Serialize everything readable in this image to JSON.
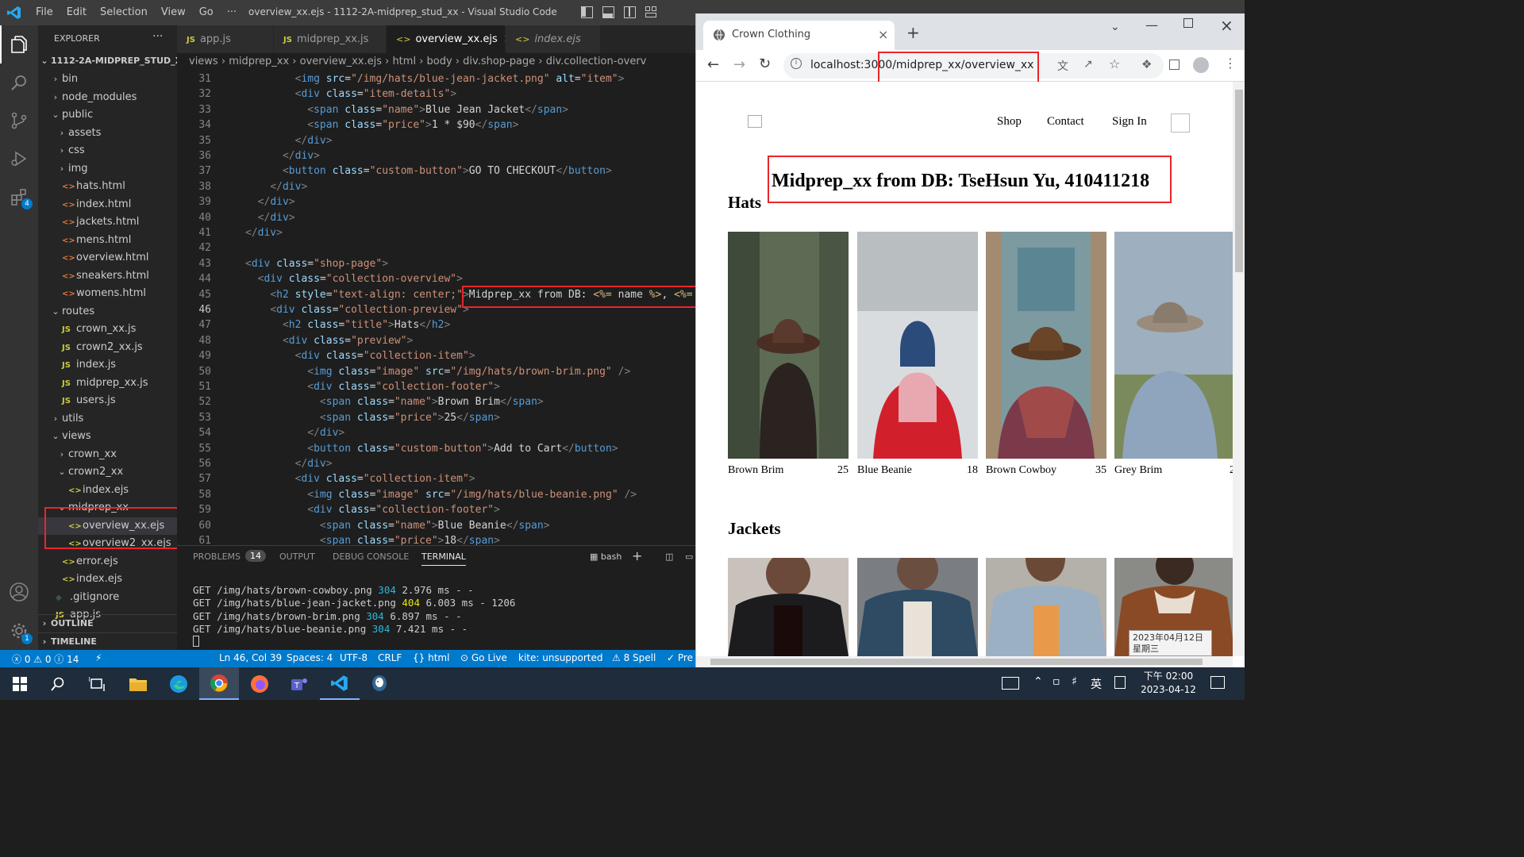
{
  "vscode": {
    "menu": [
      "File",
      "Edit",
      "Selection",
      "View",
      "Go",
      "···"
    ],
    "window_title": "overview_xx.ejs - 1112-2A-midprep_stud_xx - Visual Studio Code",
    "extensions_badge": "4",
    "settings_badge": "1"
  },
  "explorer": {
    "header": "EXPLORER",
    "more": "···",
    "root": "1112-2A-MIDPREP_STUD_XX",
    "items": [
      {
        "label": "bin",
        "kind": "folder",
        "chev": "›",
        "indent": 1
      },
      {
        "label": "node_modules",
        "kind": "folder",
        "chev": "›",
        "indent": 1
      },
      {
        "label": "public",
        "kind": "folder",
        "chev": "⌄",
        "indent": 1
      },
      {
        "label": "assets",
        "kind": "folder",
        "chev": "›",
        "indent": 2
      },
      {
        "label": "css",
        "kind": "folder",
        "chev": "›",
        "indent": 2
      },
      {
        "label": "img",
        "kind": "folder",
        "chev": "›",
        "indent": 2
      },
      {
        "label": "hats.html",
        "kind": "html",
        "indent": 2
      },
      {
        "label": "index.html",
        "kind": "html",
        "indent": 2
      },
      {
        "label": "jackets.html",
        "kind": "html",
        "indent": 2
      },
      {
        "label": "mens.html",
        "kind": "html",
        "indent": 2
      },
      {
        "label": "overview.html",
        "kind": "html",
        "indent": 2
      },
      {
        "label": "sneakers.html",
        "kind": "html",
        "indent": 2
      },
      {
        "label": "womens.html",
        "kind": "html",
        "indent": 2
      },
      {
        "label": "routes",
        "kind": "folder",
        "chev": "⌄",
        "indent": 1
      },
      {
        "label": "crown_xx.js",
        "kind": "js",
        "indent": 2
      },
      {
        "label": "crown2_xx.js",
        "kind": "js",
        "indent": 2
      },
      {
        "label": "index.js",
        "kind": "js",
        "indent": 2
      },
      {
        "label": "midprep_xx.js",
        "kind": "js",
        "indent": 2
      },
      {
        "label": "users.js",
        "kind": "js",
        "indent": 2
      },
      {
        "label": "utils",
        "kind": "folder",
        "chev": "›",
        "indent": 1
      },
      {
        "label": "views",
        "kind": "folder",
        "chev": "⌄",
        "indent": 1
      },
      {
        "label": "crown_xx",
        "kind": "folder",
        "chev": "›",
        "indent": 2
      },
      {
        "label": "crown2_xx",
        "kind": "folder",
        "chev": "⌄",
        "indent": 2
      },
      {
        "label": "index.ejs",
        "kind": "ejs",
        "indent": 3
      },
      {
        "label": "midprep_xx",
        "kind": "folder",
        "chev": "⌄",
        "indent": 2
      },
      {
        "label": "overview_xx.ejs",
        "kind": "ejs",
        "indent": 3,
        "selected": true
      },
      {
        "label": "overview2_xx.ejs",
        "kind": "ejs",
        "indent": 3
      },
      {
        "label": "error.ejs",
        "kind": "ejs",
        "indent": 2
      },
      {
        "label": "index.ejs",
        "kind": "ejs",
        "indent": 2
      },
      {
        "label": ".gitignore",
        "kind": "git",
        "indent": 1
      },
      {
        "label": "app.js",
        "kind": "js",
        "indent": 1
      }
    ],
    "outline": "OUTLINE",
    "timeline": "TIMELINE"
  },
  "tabs": [
    {
      "label": "app.js",
      "icon": "JS"
    },
    {
      "label": "midprep_xx.js",
      "icon": "JS"
    },
    {
      "label": "overview_xx.ejs",
      "icon": "<>",
      "active": true,
      "close": "×"
    },
    {
      "label": "index.ejs",
      "icon": "<>"
    }
  ],
  "breadcrumb": [
    "views",
    "midprep_xx",
    "overview_xx.ejs",
    "html",
    "body",
    "div.shop-page",
    "div.collection-overv"
  ],
  "code": {
    "line_numbers": [
      "31",
      "32",
      "33",
      "34",
      "35",
      "36",
      "37",
      "38",
      "39",
      "40",
      "41",
      "42",
      "43",
      "44",
      "45",
      "46",
      "47",
      "48",
      "49",
      "50",
      "51",
      "52",
      "53",
      "54",
      "55",
      "56",
      "57",
      "58",
      "59",
      "60",
      "61"
    ],
    "lines": [
      "        <img src=\"/img/hats/blue-jean-jacket.png\" alt=\"item\">",
      "        <div class=\"item-details\">",
      "          <span class=\"name\">Blue Jean Jacket</span>",
      "          <span class=\"price\">1 * $90</span>",
      "        </div>",
      "      </div>",
      "      <button class=\"custom-button\">GO TO CHECKOUT</button>",
      "    </div>",
      "  </div>",
      "  </div>",
      "</div>",
      "",
      "<div class=\"shop-page\">",
      "  <div class=\"collection-overview\">",
      "    <h2 style=\"text-align: center;\">Midprep_xx from DB: <%= name %>, <%=",
      "    <div class=\"collection-preview\">",
      "      <h2 class=\"title\">Hats</h2>",
      "      <div class=\"preview\">",
      "        <div class=\"collection-item\">",
      "          <img class=\"image\" src=\"/img/hats/brown-brim.png\" />",
      "          <div class=\"collection-footer\">",
      "            <span class=\"name\">Brown Brim</span>",
      "            <span class=\"price\">25</span>",
      "          </div>",
      "          <button class=\"custom-button\">Add to Cart</button>",
      "        </div>",
      "        <div class=\"collection-item\">",
      "          <img class=\"image\" src=\"/img/hats/blue-beanie.png\" />",
      "          <div class=\"collection-footer\">",
      "            <span class=\"name\">Blue Beanie</span>",
      "            <span class=\"price\">18</span>"
    ]
  },
  "panel": {
    "tabs": [
      "PROBLEMS",
      "OUTPUT",
      "DEBUG CONSOLE",
      "TERMINAL"
    ],
    "problems_count": "14",
    "shell": "bash",
    "add": "+",
    "terminal_lines": [
      "GET /img/hats/brown-cowboy.png 304 2.976 ms - -",
      "GET /img/hats/blue-jean-jacket.png 404 6.003 ms - 1206",
      "GET /img/hats/brown-brim.png 304 6.897 ms - -",
      "GET /img/hats/blue-beanie.png 304 7.421 ms - -"
    ]
  },
  "status": {
    "errors": "ⓧ 0 ⚠ 0 ⓘ 14",
    "position": "Ln 46, Col 39",
    "spaces": "Spaces: 4",
    "encoding": "UTF-8",
    "eol": "CRLF",
    "language": "{} html",
    "golive": "⊙ Go Live",
    "kite": "kite: unsupported",
    "spell": "⚠ 8 Spell",
    "prettier": "✓ Pre"
  },
  "browser": {
    "tab_title": "Crown Clothing",
    "new_tab": "+",
    "url": "localhost:3000/midprep_xx/overview_xx",
    "nav": [
      "Shop",
      "Contact",
      "Sign In"
    ],
    "heading": "Midprep_xx from DB: TseHsun Yu, 410411218",
    "sections": [
      "Hats",
      "Jackets"
    ],
    "hats": [
      {
        "name": "Brown Brim",
        "price": "25"
      },
      {
        "name": "Blue Beanie",
        "price": "18"
      },
      {
        "name": "Brown Cowboy",
        "price": "35"
      },
      {
        "name": "Grey Brim",
        "price": "2"
      }
    ],
    "tooltip": [
      "2023年04月12日",
      "星期三"
    ]
  },
  "taskbar": {
    "time": "下午 02:00",
    "date": "2023-04-12",
    "ime": "英"
  }
}
